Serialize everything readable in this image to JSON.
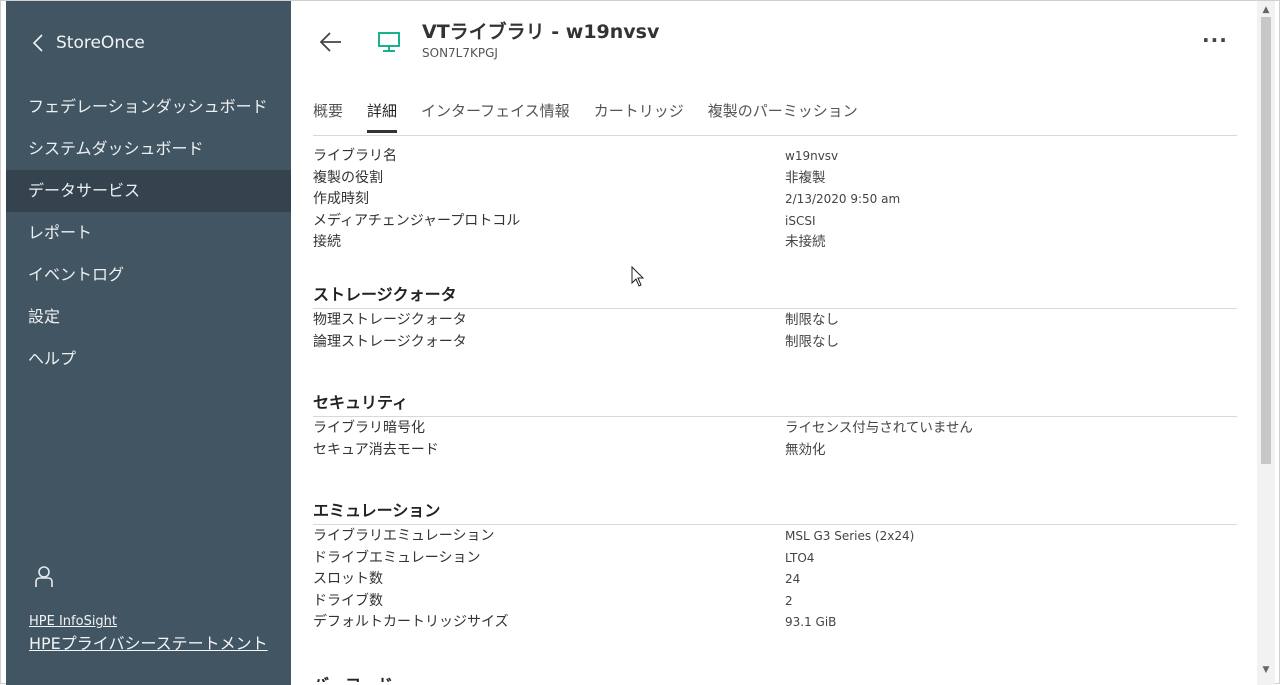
{
  "sidebar": {
    "app_title": "StoreOnce",
    "nav": [
      {
        "label": "フェデレーションダッシュボード",
        "active": false
      },
      {
        "label": "システムダッシュボード",
        "active": false
      },
      {
        "label": "データサービス",
        "active": true
      },
      {
        "label": "レポート",
        "active": false
      },
      {
        "label": "イベントログ",
        "active": false
      },
      {
        "label": "設定",
        "active": false
      },
      {
        "label": "ヘルプ",
        "active": false
      }
    ],
    "links": {
      "infosight": "HPE InfoSight",
      "privacy": "HPEプライバシーステートメント"
    }
  },
  "header": {
    "title": "VTライブラリ - w19nvsv",
    "subtitle": "SON7L7KPGJ",
    "more": "···"
  },
  "tabs": [
    {
      "label": "概要",
      "active": false
    },
    {
      "label": "詳細",
      "active": true
    },
    {
      "label": "インターフェイス情報",
      "active": false
    },
    {
      "label": "カートリッジ",
      "active": false
    },
    {
      "label": "複製のパーミッション",
      "active": false
    }
  ],
  "details": [
    {
      "label": "ライブラリ名",
      "value": "w19nvsv"
    },
    {
      "label": "複製の役割",
      "value": "非複製"
    },
    {
      "label": "作成時刻",
      "value": "2/13/2020 9:50 am"
    },
    {
      "label": "メディアチェンジャープロトコル",
      "value": "iSCSI"
    },
    {
      "label": "接続",
      "value": "未接続"
    }
  ],
  "storage": {
    "title": "ストレージクォータ",
    "rows": [
      {
        "label": "物理ストレージクォータ",
        "value": "制限なし"
      },
      {
        "label": "論理ストレージクォータ",
        "value": "制限なし"
      }
    ]
  },
  "security": {
    "title": "セキュリティ",
    "rows": [
      {
        "label": "ライブラリ暗号化",
        "value": "ライセンス付与されていません"
      },
      {
        "label": "セキュア消去モード",
        "value": "無効化"
      }
    ]
  },
  "emulation": {
    "title": "エミュレーション",
    "rows": [
      {
        "label": "ライブラリエミュレーション",
        "value": "MSL G3 Series (2x24)"
      },
      {
        "label": "ドライブエミュレーション",
        "value": "LTO4"
      },
      {
        "label": "スロット数",
        "value": "24"
      },
      {
        "label": "ドライブ数",
        "value": "2"
      },
      {
        "label": "デフォルトカートリッジサイズ",
        "value": "93.1 GiB"
      }
    ]
  },
  "cut_heading": "バーコード",
  "colors": {
    "sidebar": "#425563",
    "sidebar_active": "#34434e",
    "accent": "#01a982"
  }
}
